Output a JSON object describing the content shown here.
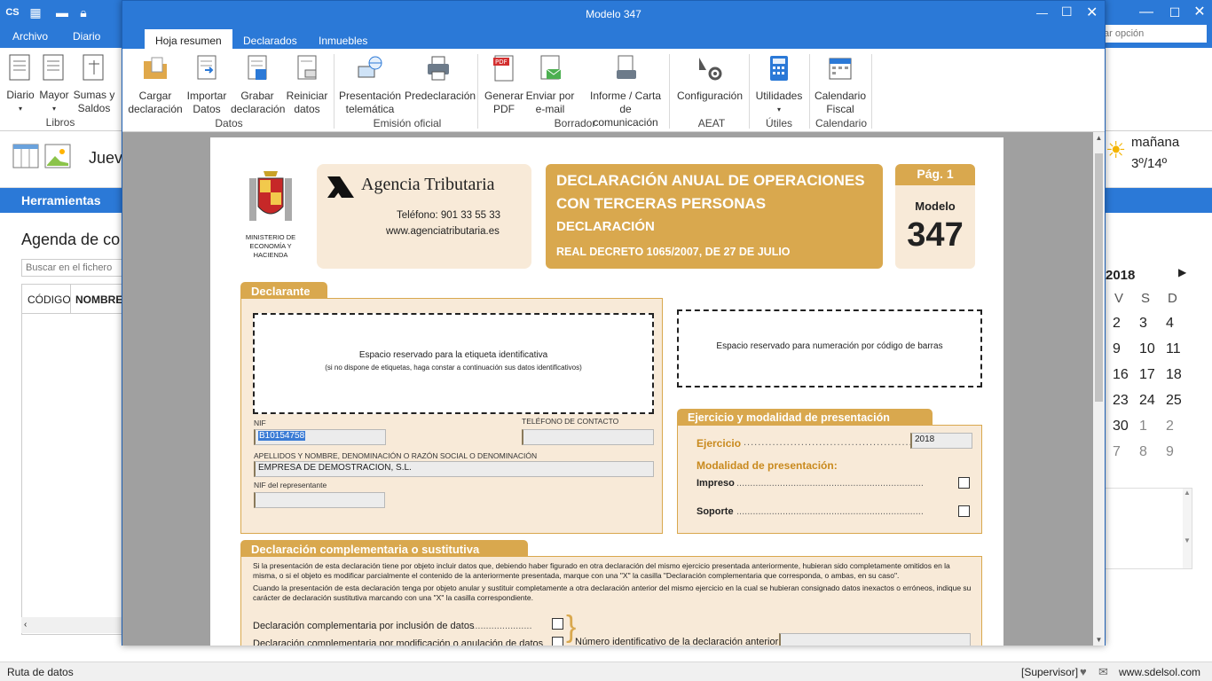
{
  "bg": {
    "tabs": [
      "Archivo",
      "Diario"
    ],
    "search_placeholder": "ar opción",
    "ribbon": [
      {
        "label": "Diario",
        "icon": "journal-icon"
      },
      {
        "label": "Mayor",
        "icon": "ledger-icon"
      },
      {
        "label": "Sumas y Saldos",
        "icon": "scales-icon"
      }
    ],
    "ribbon_group": "Libros",
    "date_fragment": "Juev",
    "herramientas": "Herramientas",
    "agenda_title": "Agenda de co",
    "search_file_placeholder": "Buscar en el fichero",
    "columns": [
      "CÓDIGO",
      "NOMBRE"
    ],
    "weather": {
      "day": "mañana",
      "temp": "3º/14º"
    },
    "calendar": {
      "year": "2018",
      "headers": [
        "V",
        "S",
        "D"
      ],
      "rows": [
        [
          "2",
          "3",
          "4"
        ],
        [
          "9",
          "10",
          "11"
        ],
        [
          "16",
          "17",
          "18"
        ],
        [
          "23",
          "24",
          "25"
        ],
        [
          "30",
          "1",
          "2"
        ],
        [
          "7",
          "8",
          "9"
        ]
      ]
    },
    "status_left": "Ruta de datos",
    "status_user": "[Supervisor]",
    "status_url": "www.sdelsol.com"
  },
  "modal": {
    "title": "Modelo 347",
    "tabs": [
      "Hoja resumen",
      "Declarados",
      "Inmuebles"
    ],
    "ribbon": [
      {
        "label": "Cargar declaración",
        "group": "Datos"
      },
      {
        "label": "Importar Datos",
        "group": "Datos"
      },
      {
        "label": "Grabar declaración",
        "group": "Datos"
      },
      {
        "label": "Reiniciar datos",
        "group": "Datos"
      },
      {
        "label": "Presentación telemática",
        "group": "Emisión oficial"
      },
      {
        "label": "Predeclaración",
        "group": "Emisión oficial"
      },
      {
        "label": "Generar PDF",
        "group": "Borrador"
      },
      {
        "label": "Enviar por e-mail",
        "group": "Borrador"
      },
      {
        "label": "Informe / Carta de comunicación",
        "group": "Borrador"
      },
      {
        "label": "Configuración",
        "group": "AEAT"
      },
      {
        "label": "Utilidades",
        "group": "Útiles"
      },
      {
        "label": "Calendario Fiscal",
        "group": "Calendario"
      }
    ],
    "groups": [
      "Datos",
      "Emisión oficial",
      "Borrador",
      "AEAT",
      "Útiles",
      "Calendario"
    ]
  },
  "form": {
    "ministry": "MINISTERIO DE ECONOMÍA Y HACIENDA",
    "agency": "Agencia Tributaria",
    "phone": "Teléfono: 901 33 55 33",
    "web": "www.agenciatributaria.es",
    "title1": "DECLARACIÓN ANUAL DE OPERACIONES",
    "title2": "CON TERCERAS PERSONAS",
    "title3": "DECLARACIÓN",
    "title4": "REAL DECRETO 1065/2007, DE 27 DE JULIO",
    "pag": "Pág. 1",
    "modelo_label": "Modelo",
    "modelo_num": "347",
    "declarante": "Declarante",
    "label_space": "Espacio reservado para la etiqueta identificativa",
    "label_space_sub": "(si no dispone de etiquetas, haga constar a continuación sus datos identificativos)",
    "barcode_space": "Espacio reservado para numeración por código de barras",
    "nif_label": "NIF",
    "nif": "B10154758",
    "tel_label": "TELÉFONO DE CONTACTO",
    "name_label": "APELLIDOS Y NOMBRE, DENOMINACIÓN O RAZÓN SOCIAL O DENOMINACIÓN",
    "name": "EMPRESA DE DEMOSTRACION, S.L.",
    "rep_label": "NIF del representante",
    "ejercicio_head": "Ejercicio y modalidad de presentación",
    "ejercicio_label": "Ejercicio",
    "ejercicio": "2018",
    "modalidad": "Modalidad de presentación:",
    "impreso": "Impreso",
    "soporte": "Soporte",
    "compl_head": "Declaración complementaria o sustitutiva",
    "compl_text1": "Si la presentación de esta declaración tiene por objeto incluir datos que, debiendo haber figurado en otra declaración del mismo ejercicio presentada anteriormente, hubieran sido completamente omitidos en la misma, o si el  objeto es modificar parcialmente el contenido de la anteriormente presentada, marque con una \"X\" la casilla \"Declaración complementaria que corresponda, o ambas, en su caso\".",
    "compl_text2": "Cuando la presentación de esta declaración tenga por objeto anular y sustituir completamente a otra declaración anterior del mismo ejercicio en la cual se hubieran consignado datos inexactos o erróneos, indique su carácter de declaración sustitutiva marcando con una \"X\" la casilla correspondiente.",
    "compl_inclusion": "Declaración complementaria por inclusión de datos",
    "compl_modif": "Declaración complementaria por modificación o anulación de datos",
    "num_ident": "Número identificativo de la declaración anterior"
  },
  "colors": {
    "blue": "#2b79d7",
    "tan": "#d9a84e",
    "cream": "#f8ead8"
  }
}
